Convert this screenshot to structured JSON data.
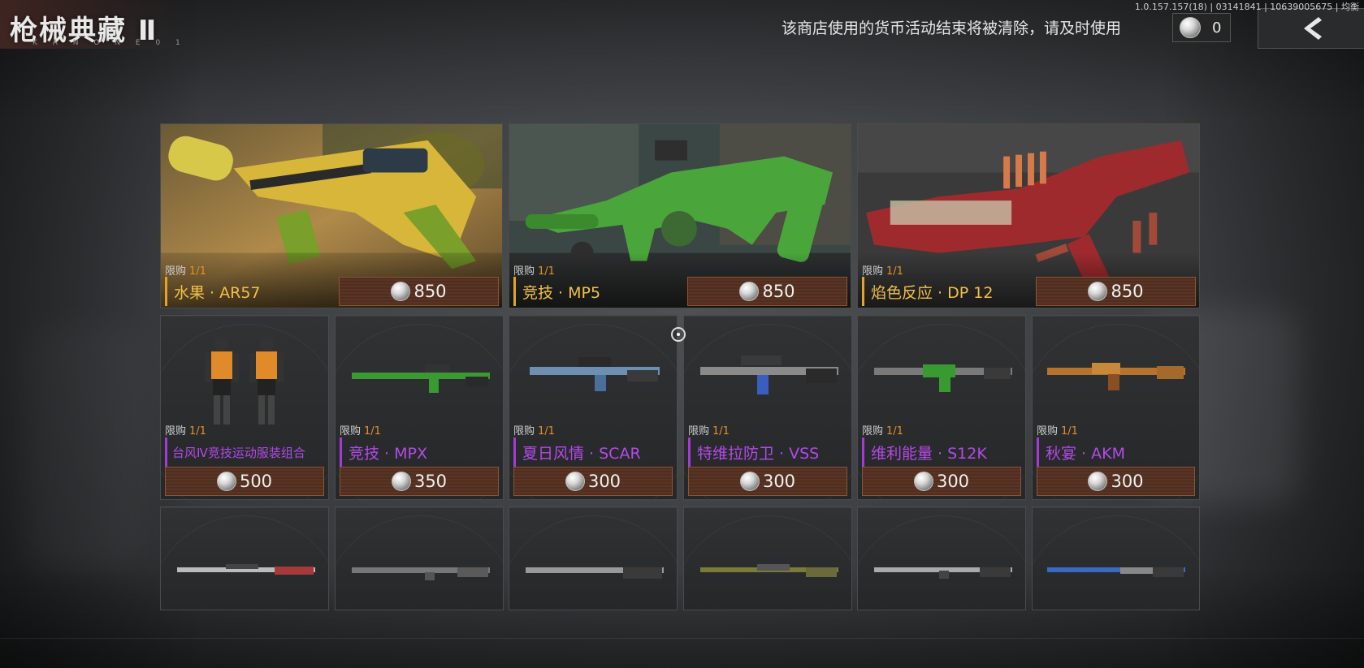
{
  "header": {
    "title": "枪械典藏 Ⅱ",
    "title_deco_text": "K A N O N E  0 1",
    "notice": "该商店使用的货币活动结束将被清除，请及时使用",
    "currency_value": "0",
    "version": "1.0.157.157(18) | 03141841 | 10639005675 | 均衡"
  },
  "colors": {
    "gold": "#f2c048",
    "purple": "#b34ae8",
    "price_bg": "#5a3424",
    "limit_count": "#e0902f"
  },
  "featured": [
    {
      "limit_label": "限购",
      "limit_count": "1/1",
      "name": "水果 · AR57",
      "price": "850",
      "rarity": "gold"
    },
    {
      "limit_label": "限购",
      "limit_count": "1/1",
      "name": "竞技 · MP5",
      "price": "850",
      "rarity": "gold"
    },
    {
      "limit_label": "限购",
      "limit_count": "1/1",
      "name": "焰色反应 · DP 12",
      "price": "850",
      "rarity": "gold"
    }
  ],
  "row2": [
    {
      "limit_label": "限购",
      "limit_count": "1/1",
      "name": "台风Ⅳ竞技运动服装组合",
      "price": "500",
      "rarity": "purple"
    },
    {
      "limit_label": "限购",
      "limit_count": "1/1",
      "name": "竞技 · MPX",
      "price": "350",
      "rarity": "purple"
    },
    {
      "limit_label": "限购",
      "limit_count": "1/1",
      "name": "夏日风情 · SCAR",
      "price": "300",
      "rarity": "purple"
    },
    {
      "limit_label": "限购",
      "limit_count": "1/1",
      "name": "特维拉防卫 · VSS",
      "price": "300",
      "rarity": "purple"
    },
    {
      "limit_label": "限购",
      "limit_count": "1/1",
      "name": "维利能量 · S12K",
      "price": "300",
      "rarity": "purple"
    },
    {
      "limit_label": "限购",
      "limit_count": "1/1",
      "name": "秋宴 · AKM",
      "price": "300",
      "rarity": "purple"
    }
  ],
  "icons": {
    "currency": "silver-coin-icon",
    "back": "chevron-left-icon",
    "cursor": "crosshair-icon"
  }
}
